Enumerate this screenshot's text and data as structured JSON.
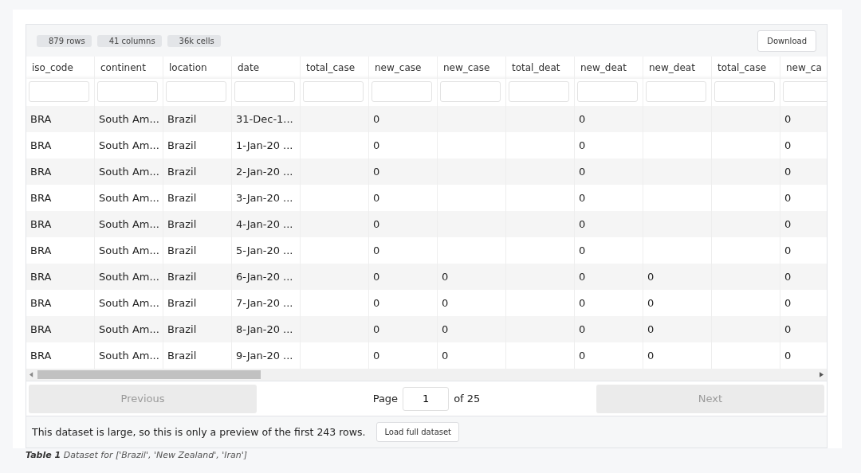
{
  "stats": [
    "879 rows",
    "41 columns",
    "36k cells"
  ],
  "download": "Download",
  "columns": [
    "iso_code",
    "continent",
    "location",
    "date",
    "total_case",
    "new_case",
    "new_case",
    "total_deat",
    "new_deat",
    "new_deat",
    "total_case",
    "new_ca"
  ],
  "rows": [
    [
      "BRA",
      "South Am...",
      "Brazil",
      "31-Dec-1...",
      null,
      "0",
      null,
      null,
      "0",
      null,
      null,
      "0"
    ],
    [
      "BRA",
      "South Am...",
      "Brazil",
      "1-Jan-20 ...",
      null,
      "0",
      null,
      null,
      "0",
      null,
      null,
      "0"
    ],
    [
      "BRA",
      "South Am...",
      "Brazil",
      "2-Jan-20 ...",
      null,
      "0",
      null,
      null,
      "0",
      null,
      null,
      "0"
    ],
    [
      "BRA",
      "South Am...",
      "Brazil",
      "3-Jan-20 ...",
      null,
      "0",
      null,
      null,
      "0",
      null,
      null,
      "0"
    ],
    [
      "BRA",
      "South Am...",
      "Brazil",
      "4-Jan-20 ...",
      null,
      "0",
      null,
      null,
      "0",
      null,
      null,
      "0"
    ],
    [
      "BRA",
      "South Am...",
      "Brazil",
      "5-Jan-20 ...",
      null,
      "0",
      null,
      null,
      "0",
      null,
      null,
      "0"
    ],
    [
      "BRA",
      "South Am...",
      "Brazil",
      "6-Jan-20 ...",
      null,
      "0",
      "0",
      null,
      "0",
      "0",
      null,
      "0"
    ],
    [
      "BRA",
      "South Am...",
      "Brazil",
      "7-Jan-20 ...",
      null,
      "0",
      "0",
      null,
      "0",
      "0",
      null,
      "0"
    ],
    [
      "BRA",
      "South Am...",
      "Brazil",
      "8-Jan-20 ...",
      null,
      "0",
      "0",
      null,
      "0",
      "0",
      null,
      "0"
    ],
    [
      "BRA",
      "South Am...",
      "Brazil",
      "9-Jan-20 ...",
      null,
      "0",
      "0",
      null,
      "0",
      "0",
      null,
      "0"
    ]
  ],
  "pagination": {
    "previous": {
      "label": "Previous",
      "disabled": true
    },
    "page_label": "Page",
    "page": "1",
    "of": "of 25",
    "next": {
      "label": "Next",
      "disabled": true
    }
  },
  "notice": "This dataset is large, so this is only a preview of the first 243 rows.",
  "load_button": "Load full dataset",
  "caption": "**Table 1** Dataset for ['Brazil', 'New Zealand', 'Iran']"
}
